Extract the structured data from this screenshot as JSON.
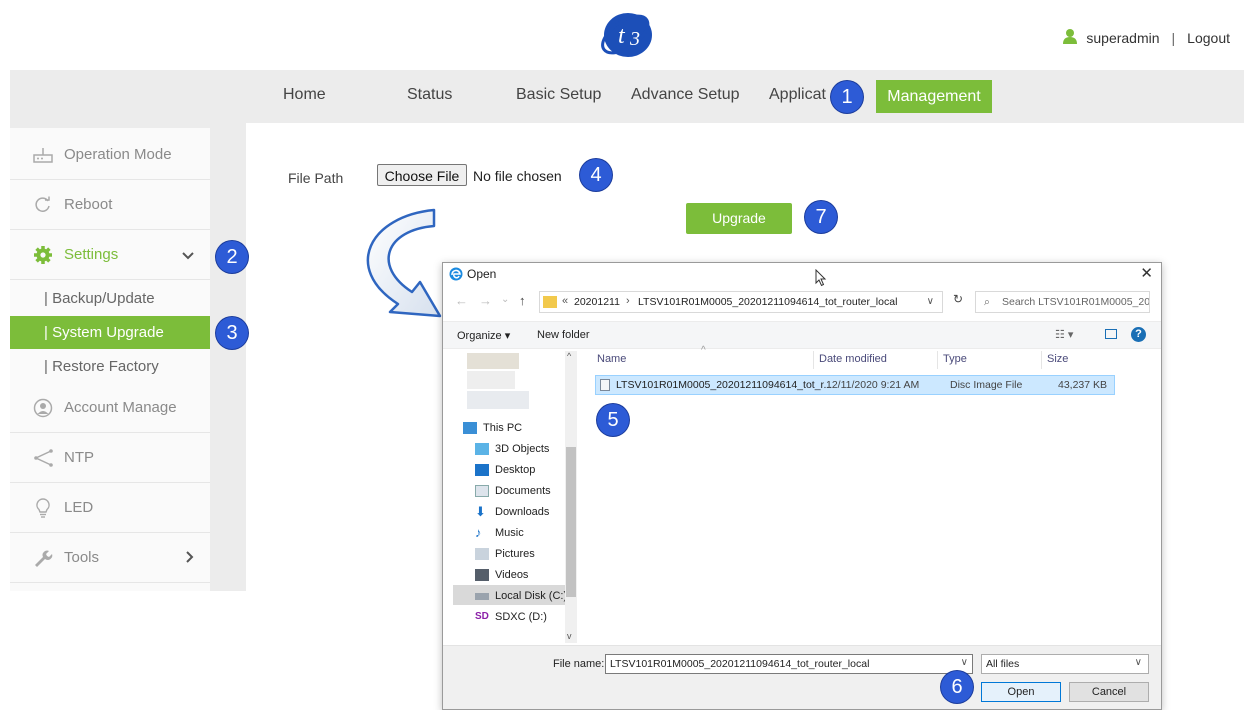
{
  "header": {
    "username": "superadmin",
    "separator": "|",
    "logout_label": "Logout"
  },
  "nav": {
    "items": [
      "Home",
      "Status",
      "Basic Setup",
      "Advance Setup",
      "Applicat"
    ],
    "active": "Management"
  },
  "sidebar": {
    "items": [
      {
        "label": "Operation Mode",
        "icon": "router-icon"
      },
      {
        "label": "Reboot",
        "icon": "refresh-icon"
      },
      {
        "label": "Settings",
        "icon": "gear-icon"
      },
      {
        "label": "Account Manage",
        "icon": "user-circle-icon"
      },
      {
        "label": "NTP",
        "icon": "share-icon"
      },
      {
        "label": "LED",
        "icon": "lightbulb-icon"
      },
      {
        "label": "Tools",
        "icon": "wrench-icon"
      }
    ],
    "subitems": [
      "| Backup/Update",
      "| System Upgrade",
      "| Restore Factory"
    ]
  },
  "main": {
    "file_path_label": "File Path",
    "choose_file_label": "Choose File",
    "no_file_text": "No file chosen",
    "upgrade_label": "Upgrade"
  },
  "badges": [
    "1",
    "2",
    "3",
    "4",
    "5",
    "6",
    "7"
  ],
  "dialog": {
    "title": "Open",
    "breadcrumb_prefix": "«",
    "breadcrumb": [
      "20201211",
      "LTSV101R01M0005_20201211094614_tot_router_local"
    ],
    "search_placeholder": "Search LTSV101R01M0005_20...",
    "organize_label": "Organize ▾",
    "new_folder_label": "New folder",
    "columns": [
      "Name",
      "Date modified",
      "Type",
      "Size"
    ],
    "file_row": {
      "name": "LTSV101R01M0005_20201211094614_tot_r...",
      "date": "12/11/2020 9:21 AM",
      "type": "Disc Image File",
      "size": "43,237 KB"
    },
    "tree": [
      "This PC",
      "3D Objects",
      "Desktop",
      "Documents",
      "Downloads",
      "Music",
      "Pictures",
      "Videos",
      "Local Disk (C:)",
      "SDXC (D:)"
    ],
    "file_name_label": "File name:",
    "file_name_value": "LTSV101R01M0005_20201211094614_tot_router_local",
    "filter_value": "All files",
    "open_label": "Open",
    "cancel_label": "Cancel"
  },
  "colors": {
    "accent_green": "#7cbd3a",
    "badge_blue": "#2d5bd6",
    "selection_blue": "#cce8ff"
  }
}
